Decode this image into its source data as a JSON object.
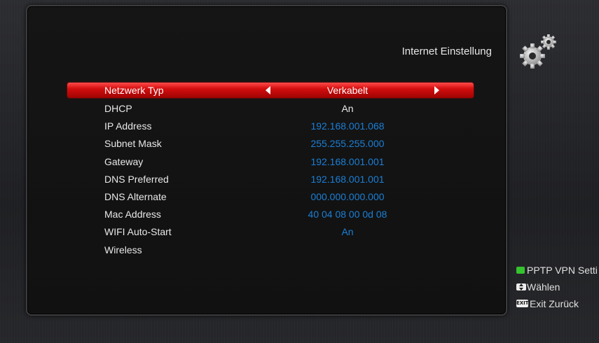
{
  "header": {
    "title": "Internet Einstellung",
    "icon": "gears-icon"
  },
  "settings": [
    {
      "label": "Netzwerk Typ",
      "value": "Verkabelt",
      "selected": true
    },
    {
      "label": "DHCP",
      "value": "An"
    },
    {
      "label": "IP Address",
      "value": "192.168.001.068"
    },
    {
      "label": "Subnet Mask",
      "value": "255.255.255.000"
    },
    {
      "label": "Gateway",
      "value": "192.168.001.001"
    },
    {
      "label": "DNS Preferred",
      "value": "192.168.001.001"
    },
    {
      "label": "DNS Alternate",
      "value": "000.000.000.000"
    },
    {
      "label": "Mac Address",
      "value": "40 04 08 00 0d 08"
    },
    {
      "label": "WIFI Auto-Start",
      "value": "An"
    },
    {
      "label": "Wireless",
      "value": ""
    }
  ],
  "legend": {
    "green": "PPTP VPN Setti",
    "select": "Wählen",
    "exit_key": "EXIT",
    "exit": "Exit Zurück"
  },
  "colors": {
    "selected_bar": "#d40e0e",
    "value_blue": "#1b7fd6",
    "green_key": "#35c22f"
  }
}
